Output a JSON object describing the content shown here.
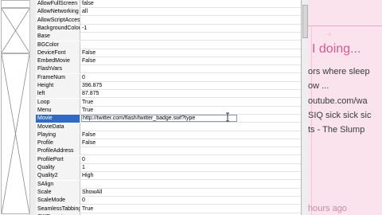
{
  "properties": [
    {
      "name": "AllowFullScreen",
      "value": "false"
    },
    {
      "name": "AllowNetworking",
      "value": "all"
    },
    {
      "name": "AllowScriptAccess",
      "value": ""
    },
    {
      "name": "BackgroundColor",
      "value": "-1"
    },
    {
      "name": "Base",
      "value": ""
    },
    {
      "name": "BGColor",
      "value": ""
    },
    {
      "name": "DeviceFont",
      "value": "False"
    },
    {
      "name": "EmbedMovie",
      "value": "False"
    },
    {
      "name": "FlashVars",
      "value": ""
    },
    {
      "name": "FrameNum",
      "value": "0"
    },
    {
      "name": "Height",
      "value": "396.875"
    },
    {
      "name": "left",
      "value": "87.875"
    },
    {
      "name": "Loop",
      "value": "True"
    },
    {
      "name": "Menu",
      "value": "True"
    },
    {
      "name": "Movie",
      "value": "http://twitter.com/flash/twitter_badge.swf?type"
    },
    {
      "name": "MovieData",
      "value": ""
    },
    {
      "name": "Playing",
      "value": "False"
    },
    {
      "name": "Profile",
      "value": "False"
    },
    {
      "name": "ProfileAddress",
      "value": ""
    },
    {
      "name": "ProfilePort",
      "value": "0"
    },
    {
      "name": "Quality",
      "value": "1"
    },
    {
      "name": "Quality2",
      "value": "High"
    },
    {
      "name": "SAlign",
      "value": ""
    },
    {
      "name": "Scale",
      "value": "ShowAll"
    },
    {
      "name": "ScaleMode",
      "value": "0"
    },
    {
      "name": "SeamlessTabbing",
      "value": "True"
    },
    {
      "name": "SWRemote",
      "value": ""
    }
  ],
  "selected_property": "Movie",
  "colors": {
    "selection": "#316ac5",
    "page_bg": "#fbe3ee",
    "accent_pink": "#d35a92"
  },
  "webpage": {
    "heading": "I doing...",
    "lines": [
      "ors where sleep",
      "ow ...",
      "outube.com/wa",
      "SIQ sick sick sic",
      "ts - The Slump"
    ],
    "time": "hours ago"
  }
}
